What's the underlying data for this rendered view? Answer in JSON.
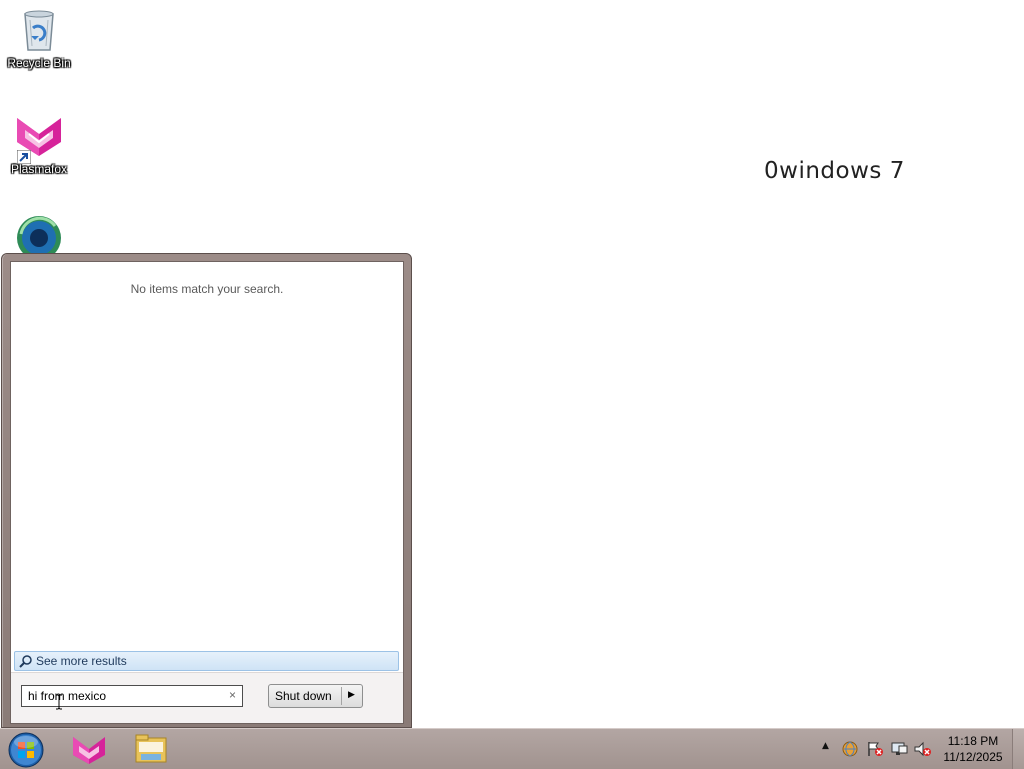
{
  "desktop": {
    "icons": [
      {
        "label": "Recycle Bin",
        "icon": "recycle-bin-icon"
      },
      {
        "label": "Plasmafox",
        "icon": "plasmafox-icon"
      },
      {
        "label": "",
        "icon": "browser-globe-icon"
      }
    ],
    "watermark": "0windows 7"
  },
  "start_menu": {
    "no_results_text": "No items match your search.",
    "see_more_label": "See more results",
    "search": {
      "value": "hi from mexico",
      "clear_glyph": "×"
    },
    "shutdown_label": "Shut down",
    "shutdown_arrow": "▶"
  },
  "taskbar": {
    "pinned": [
      "windows-start-orb",
      "plasmafox-icon",
      "file-explorer-icon"
    ],
    "tray_icons": [
      "show-hidden-icons-arrow",
      "network-globe-icon",
      "action-center-flag-icon",
      "network-monitor-icon",
      "volume-muted-icon"
    ],
    "tray_arrow": "▲",
    "clock": {
      "time": "11:18 PM",
      "date": "11/12/2025"
    }
  },
  "colors": {
    "taskbar": "#a99b98",
    "start_frame": "#958581",
    "see_more_bg": "#d9e8f7",
    "desktop": "#ffffff"
  }
}
